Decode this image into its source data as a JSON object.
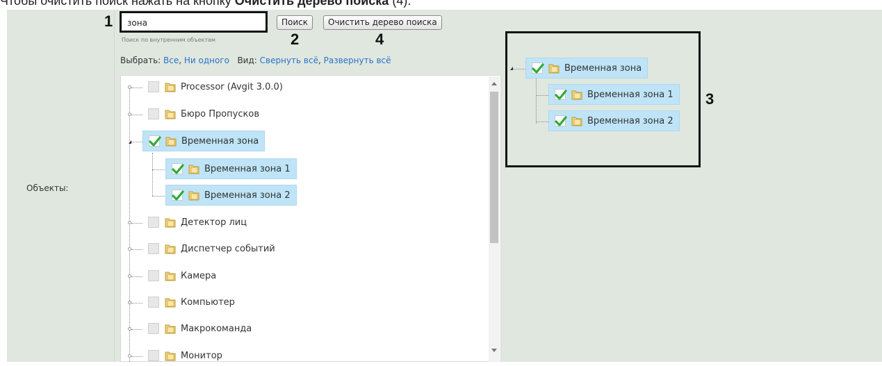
{
  "caption": {
    "text_before": "Чтобы очистить поиск нажать на кнопку ",
    "bold": "Очистить дерево поиска",
    "text_after": " (4)."
  },
  "form": {
    "objects_label": "Объекты:",
    "search_value": "зона",
    "search_hint": "Поиск по внутренним объектам",
    "search_button": "Поиск",
    "clear_button": "Очистить дерево поиска",
    "select_label": "Выбрать:",
    "select_all": "Все",
    "select_none": "Ни одного",
    "view_label": "Вид:",
    "collapse_all": "Свернуть всё",
    "expand_all": "Развернуть всё"
  },
  "markers": {
    "m1": "1",
    "m2": "2",
    "m3": "3",
    "m4": "4"
  },
  "tree": {
    "items": [
      {
        "label": "Processor (Avgit 3.0.0)",
        "checked": false
      },
      {
        "label": "Бюро Пропусков",
        "checked": false
      },
      {
        "label": "Временная зона",
        "checked": true
      },
      {
        "label": "Временная зона 1",
        "checked": true
      },
      {
        "label": "Временная зона 2",
        "checked": true
      },
      {
        "label": "Детектор лиц",
        "checked": false
      },
      {
        "label": "Диспетчер событий",
        "checked": false
      },
      {
        "label": "Камера",
        "checked": false
      },
      {
        "label": "Компьютер",
        "checked": false
      },
      {
        "label": "Макрокоманда",
        "checked": false
      },
      {
        "label": "Монитор",
        "checked": false
      }
    ]
  },
  "search_tree": {
    "items": [
      {
        "label": "Временная зона",
        "checked": true
      },
      {
        "label": "Временная зона 1",
        "checked": true
      },
      {
        "label": "Временная зона 2",
        "checked": true
      }
    ]
  },
  "icons": {
    "check": "green-checkmark-icon",
    "folder": "folder-icon",
    "check_color": "#2eaa3a",
    "link_color": "#2a72c7",
    "selected_bg": "#bfe4f7"
  }
}
